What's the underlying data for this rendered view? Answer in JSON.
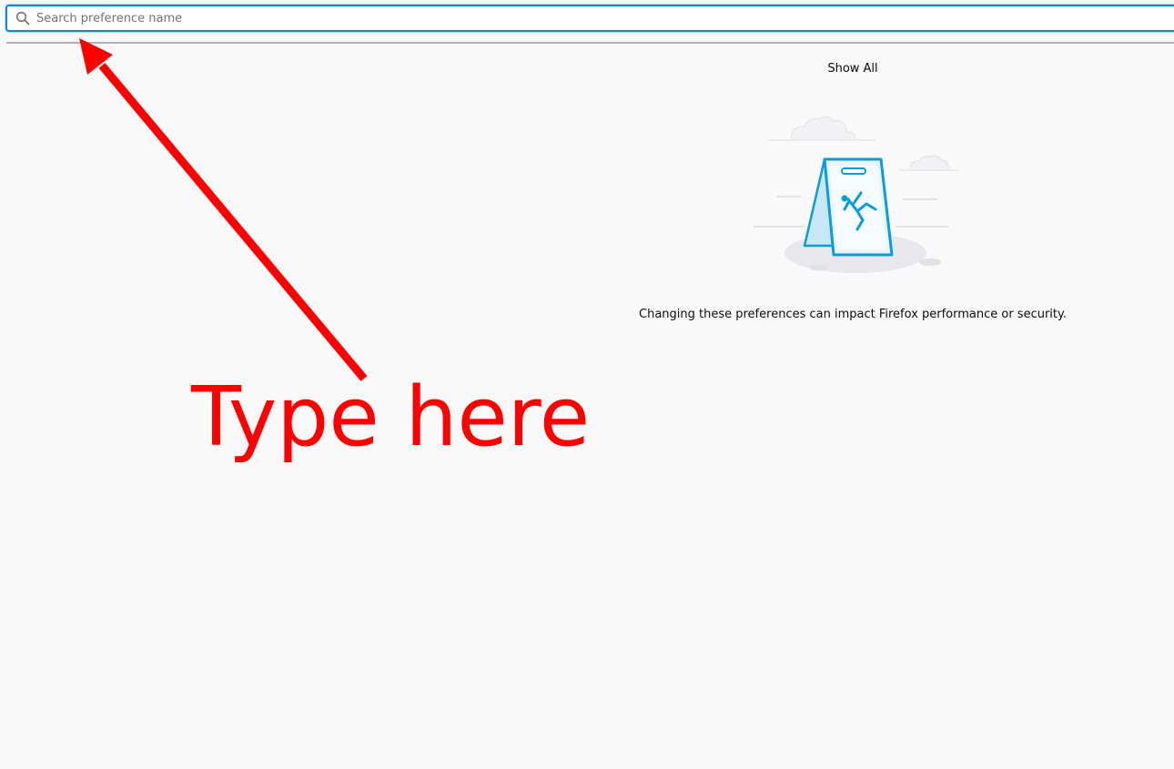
{
  "search": {
    "placeholder": "Search preference name",
    "value": "",
    "icon": "search-icon"
  },
  "main": {
    "show_all_label": "Show All",
    "warning_text": "Changing these preferences can impact Firefox performance or security.",
    "illustration": "caution-sign-illustration"
  },
  "annotation": {
    "text": "Type here",
    "color": "#ff0000",
    "icon": "arrow-icon"
  },
  "colors": {
    "accent": "#0a84ff",
    "background": "#f9f9fa",
    "illustration_blue": "#0a9dde"
  }
}
